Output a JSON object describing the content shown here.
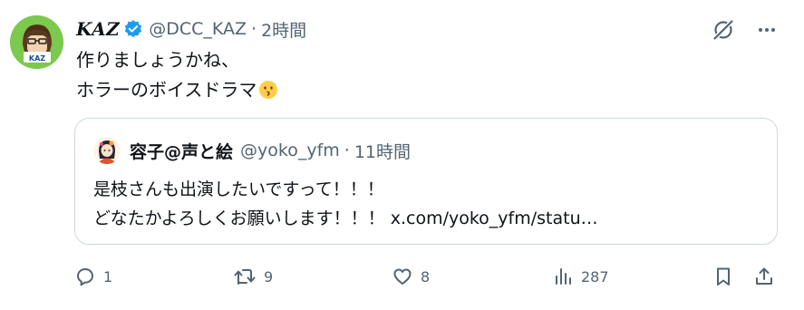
{
  "author": {
    "display_name": "KAZ",
    "handle": "@DCC_KAZ",
    "separator": "·",
    "time": "2時間",
    "verified": true,
    "avatar_label": "KAZ"
  },
  "tweet": {
    "line1": "作りましょうかね、",
    "line2": "ホラーのボイスドラマ",
    "emoji": "kissing-face-emoji"
  },
  "quoted": {
    "display_name": "容子@声と絵",
    "handle": "@yoko_yfm",
    "separator": "·",
    "time": "11時間",
    "line1": "是枝さんも出演したいですって！！！",
    "line2_text": "どなたかよろしくお願いします！！！",
    "line2_link": "x.com/yoko_yfm/statu…"
  },
  "actions": {
    "replies": "1",
    "reposts": "9",
    "likes": "8",
    "views": "287"
  },
  "colors": {
    "text": "#0f1419",
    "muted": "#536471",
    "verified": "#1d9bf0",
    "border": "#cfd9de",
    "avatar_bg": "#6cc24a"
  }
}
